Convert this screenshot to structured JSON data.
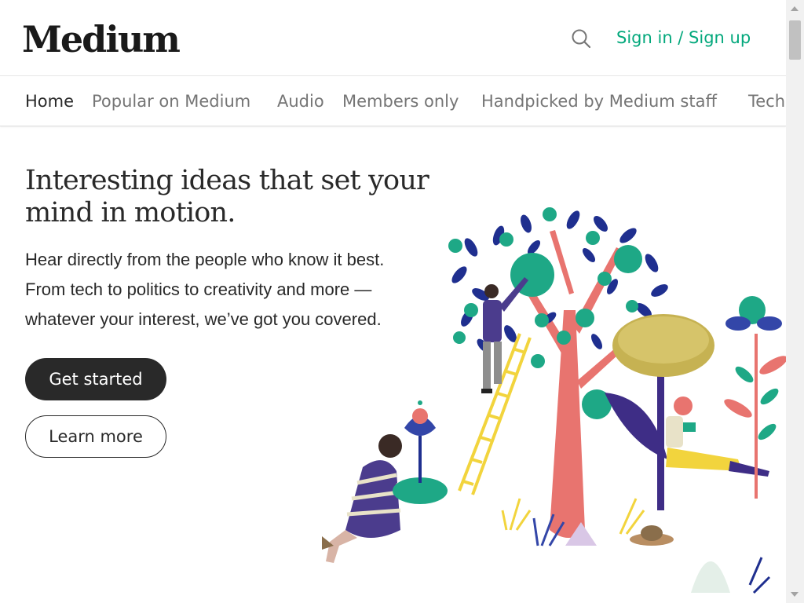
{
  "header": {
    "logo": "Medium",
    "search_icon": "search-icon",
    "signin_label": "Sign in / Sign up"
  },
  "nav": {
    "items": [
      {
        "label": "Home",
        "active": true
      },
      {
        "label": "Popular on Medium",
        "active": false
      },
      {
        "label": "Audio",
        "active": false
      },
      {
        "label": "Members only",
        "active": false
      },
      {
        "label": "Handpicked by Medium staff",
        "active": false
      },
      {
        "label": "Tech",
        "active": false
      }
    ]
  },
  "hero": {
    "headline": "Interesting ideas that set your mind in motion.",
    "sub_lines": [
      "Hear directly from the people who know it best.",
      "From tech to politics to creativity and more —",
      "whatever your interest, we’ve got you covered."
    ],
    "primary_button": "Get started",
    "secondary_button": "Learn more"
  },
  "colors": {
    "accent": "#03a87c",
    "text": "#292929",
    "muted": "#757575",
    "button_dark": "#292929"
  }
}
